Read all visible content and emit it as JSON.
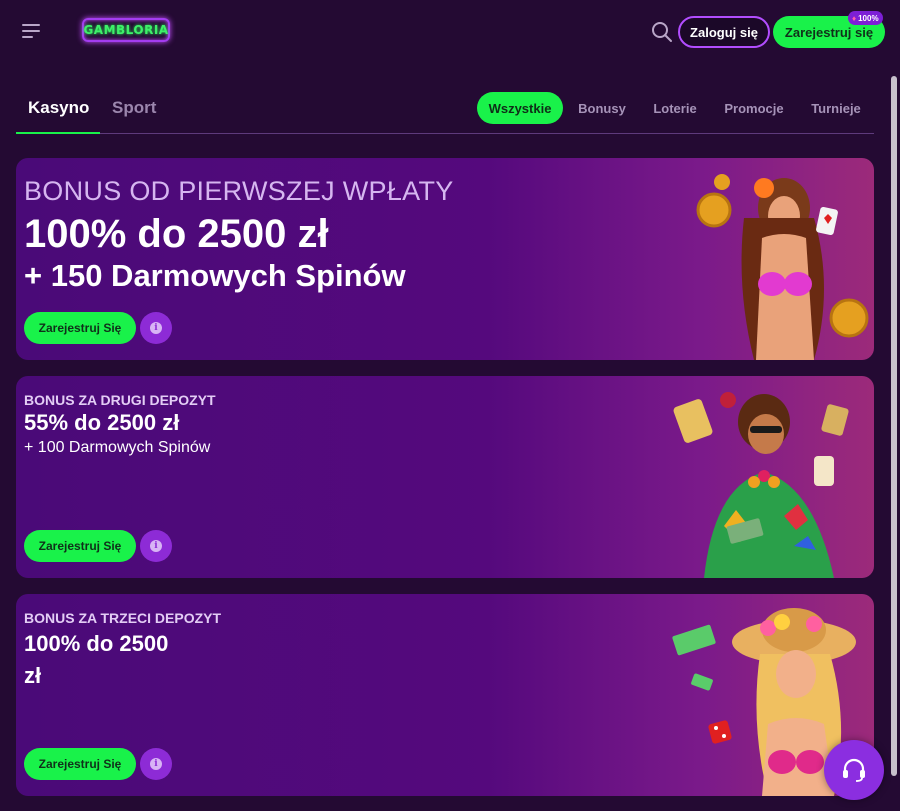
{
  "header": {
    "logo_text": "GAMBLORIA",
    "login_label": "Zaloguj się",
    "register_label": "Zarejestruj się",
    "register_badge": "100%"
  },
  "tabs": {
    "main": [
      {
        "label": "Kasyno",
        "active": true
      },
      {
        "label": "Sport",
        "active": false
      }
    ],
    "filters": [
      {
        "label": "Wszystkie",
        "active": true
      },
      {
        "label": "Bonusy",
        "active": false
      },
      {
        "label": "Loterie",
        "active": false
      },
      {
        "label": "Promocje",
        "active": false
      },
      {
        "label": "Turnieje",
        "active": false
      }
    ]
  },
  "cards": [
    {
      "title": "BONUS OD PIERWSZEJ WPŁATY",
      "headline": "100% do 2500 zł",
      "subline": "+ 150 Darmowych Spinów",
      "cta": "Zarejestruj Się"
    },
    {
      "title": "BONUS ZA DRUGI DEPOZYT",
      "headline": "55% do 2500 zł",
      "subline": "+ 100 Darmowych Spinów",
      "cta": "Zarejestruj Się"
    },
    {
      "title": "BONUS ZA TRZECI DEPOZYT",
      "headline": "100% do 2500 zł",
      "cta": "Zarejestruj Się"
    }
  ],
  "colors": {
    "background": "#240a33",
    "accent_green": "#19f24a",
    "accent_purple": "#8b2ee0"
  },
  "icons": {
    "menu": "menu-icon",
    "search": "search-icon",
    "info": "info-icon",
    "support": "headset-icon"
  }
}
